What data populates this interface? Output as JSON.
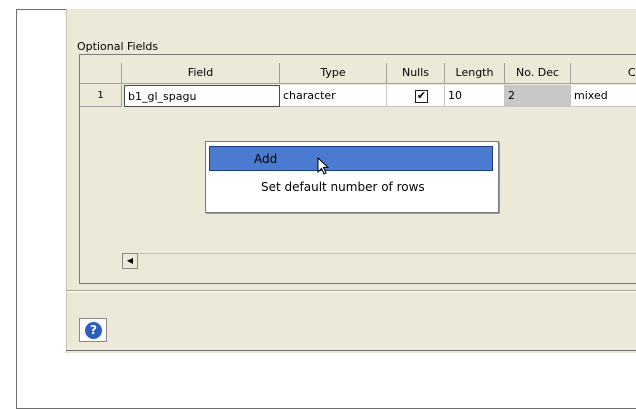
{
  "section": {
    "label": "Optional Fields"
  },
  "grid": {
    "columns": [
      "Field",
      "Type",
      "Nulls",
      "Length",
      "No. Dec",
      "Cas"
    ],
    "rows": [
      {
        "num": "1",
        "field": "b1_gl_spagu",
        "type": "character",
        "nulls": "✔",
        "length": "10",
        "no_dec": "2",
        "case": "mixed"
      }
    ]
  },
  "context_menu": {
    "items": [
      {
        "label": "Add"
      },
      {
        "label": "Set default number of rows"
      }
    ]
  },
  "scrollbar": {
    "left_arrow": "◀"
  },
  "help": {
    "symbol": "?"
  }
}
